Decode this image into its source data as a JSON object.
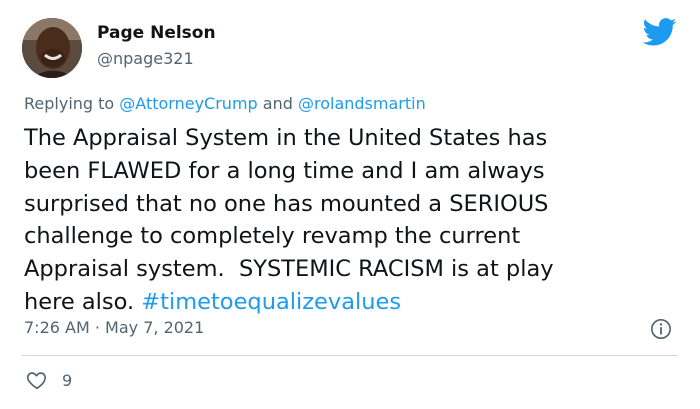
{
  "author": {
    "display_name": "Page Nelson",
    "handle": "@npage321",
    "avatar_icon": "user-avatar-photo"
  },
  "platform_icon": "twitter-bird-icon",
  "reply_context": {
    "prefix": "Replying to",
    "mention_1": "@AttorneyCrump",
    "joiner": "and",
    "mention_2": "@rolandsmartin"
  },
  "tweet": {
    "lines": [
      "The Appraisal System in the United States has",
      "been FLAWED for a long time and I am always",
      "surprised that no one has mounted a SERIOUS",
      "challenge to completely revamp the current",
      "Appraisal system.  SYSTEMIC RACISM is at play"
    ],
    "last_line_prefix": "here also. ",
    "hashtag": "#timetoequalizevalues"
  },
  "meta": {
    "time": "7:26 AM",
    "separator": "·",
    "date": "May 7, 2021"
  },
  "actions": {
    "like_count": "9"
  },
  "colors": {
    "accent": "#1d9bf0",
    "secondary_text": "#536471",
    "divider": "#cfd9de"
  }
}
